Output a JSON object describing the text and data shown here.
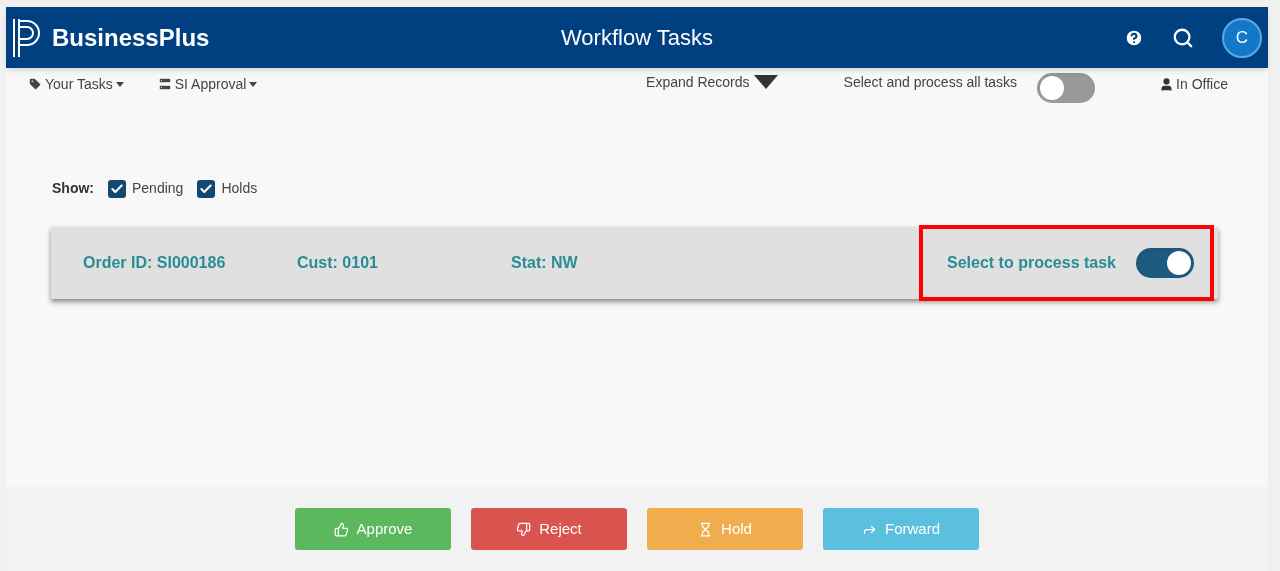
{
  "header": {
    "brand": "BusinessPlus",
    "title": "Workflow Tasks",
    "avatar": "C"
  },
  "toolbar": {
    "menus": [
      {
        "label": "Your Tasks",
        "kind": "tag"
      },
      {
        "label": "SI Approval",
        "kind": "list"
      }
    ],
    "expand": "Expand Records",
    "process_all": {
      "label": "Select and process all tasks",
      "on": false
    },
    "status": "In Office"
  },
  "show": {
    "label": "Show:",
    "filters": [
      {
        "label": "Pending",
        "checked": true
      },
      {
        "label": "Holds",
        "checked": true
      }
    ]
  },
  "tasks": [
    {
      "fields": [
        "Order ID: SI000186",
        "Cust: 0101",
        "Stat: NW"
      ],
      "select_label": "Select to process task",
      "on": true,
      "highlighted": true
    }
  ],
  "actions": [
    {
      "label": "Approve",
      "kind": "approve"
    },
    {
      "label": "Reject",
      "kind": "reject"
    },
    {
      "label": "Hold",
      "kind": "hold"
    },
    {
      "label": "Forward",
      "kind": "forward"
    }
  ]
}
